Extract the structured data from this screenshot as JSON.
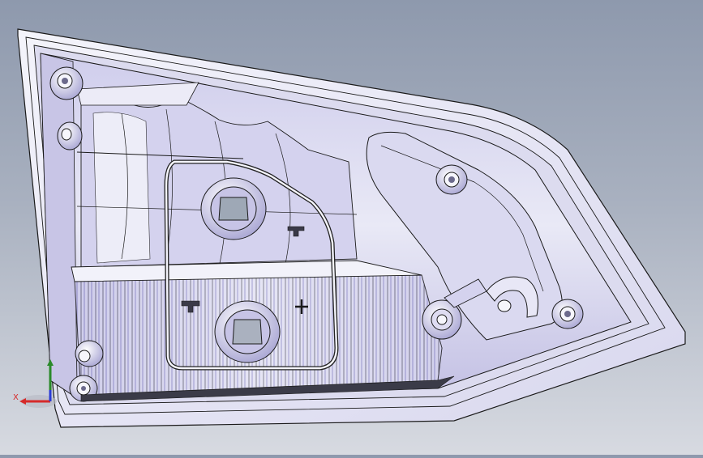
{
  "viewport": {
    "background_top": "#8e99ad",
    "background_bottom": "#d7dae1",
    "model_fill": "#e6e6f4",
    "model_shade": "#b6b3dc",
    "edge_color": "#1a1a1a"
  },
  "triad": {
    "x_label": "X",
    "x_color": "#d62a2a",
    "y_color": "#2a8a2a",
    "z_color": "#2a3ad6"
  }
}
